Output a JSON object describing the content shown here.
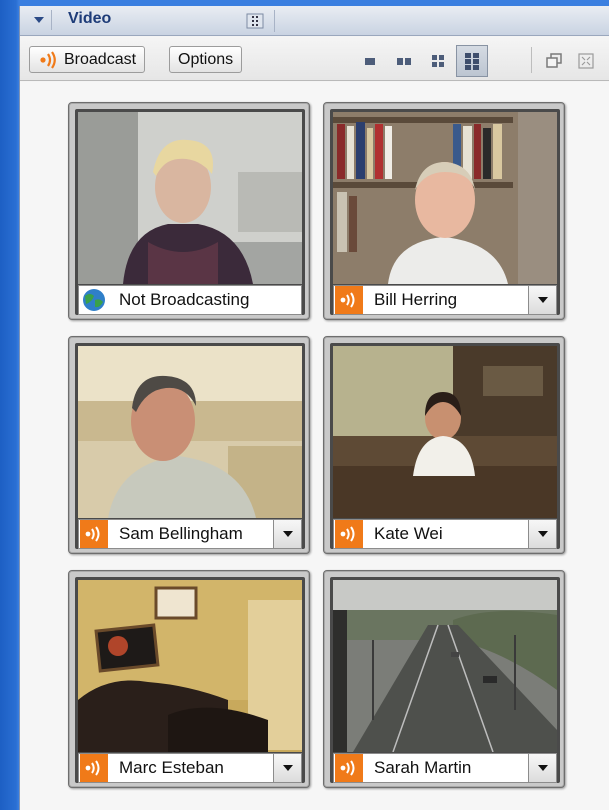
{
  "panel": {
    "title": "Video"
  },
  "toolbar": {
    "broadcast_label": "Broadcast",
    "options_label": "Options",
    "layouts": [
      "layout-1x1-icon",
      "layout-1x2-icon",
      "layout-2x2-icon",
      "layout-3x2-icon"
    ],
    "active_layout_index": 3
  },
  "colors": {
    "broadcast_accent": "#f07a19",
    "panel_blue": "#1d5fc4",
    "title_text": "#1e3c78"
  },
  "tiles": [
    {
      "name": "Not Broadcasting",
      "status": "not-broadcasting",
      "has_dropdown": false
    },
    {
      "name": "Bill Herring",
      "status": "broadcasting",
      "has_dropdown": true
    },
    {
      "name": "Sam Bellingham",
      "status": "broadcasting",
      "has_dropdown": true
    },
    {
      "name": "Kate Wei",
      "status": "broadcasting",
      "has_dropdown": true
    },
    {
      "name": "Marc Esteban",
      "status": "broadcasting",
      "has_dropdown": true
    },
    {
      "name": "Sarah Martin",
      "status": "broadcasting",
      "has_dropdown": true
    }
  ]
}
